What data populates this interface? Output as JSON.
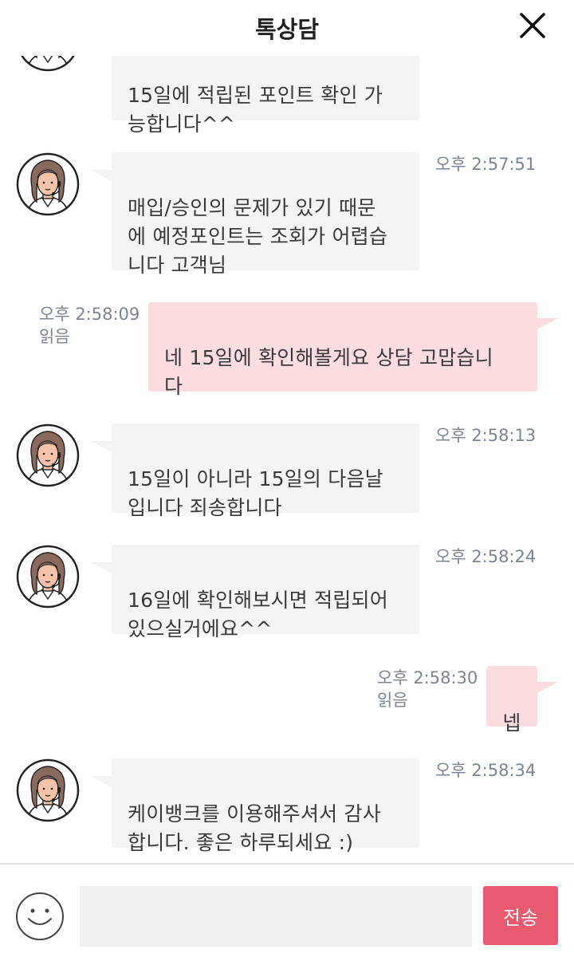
{
  "header": {
    "title": "톡상담"
  },
  "messages": [
    {
      "sender": "agent",
      "text": "15일에 적립된 포인트 확인 가\n능합니다^^",
      "time": ""
    },
    {
      "sender": "agent",
      "text": "매입/승인의 문제가 있기 때문\n에 예정포인트는 조회가 어렵습\n니다 고객님",
      "time": "오후 2:57:51"
    },
    {
      "sender": "user",
      "text": "네 15일에 확인해볼게요 상담 고맙습니\n다",
      "time": "오후 2:58:09",
      "read": "읽음"
    },
    {
      "sender": "agent",
      "text": "15일이 아니라 15일의 다음날\n입니다 죄송합니다",
      "time": "오후 2:58:13"
    },
    {
      "sender": "agent",
      "text": "16일에 확인해보시면 적립되어\n있으실거에요^^",
      "time": "오후 2:58:24"
    },
    {
      "sender": "user",
      "text": "넵",
      "time": "오후 2:58:30",
      "read": "읽음"
    },
    {
      "sender": "agent",
      "text": "케이뱅크를 이용해주셔서 감사\n합니다. 좋은 하루되세요 :)",
      "time": "오후 2:58:34"
    }
  ],
  "composer": {
    "input_value": "",
    "send_label": "전송",
    "emoji_icon": "smiley-icon"
  },
  "icons": {
    "close": "close-icon",
    "avatar": "agent-avatar"
  },
  "colors": {
    "agent_bubble": "#f4f4f2",
    "user_bubble": "#fbdde0",
    "send_button": "#e85a6e",
    "timestamp": "#7b8592"
  }
}
